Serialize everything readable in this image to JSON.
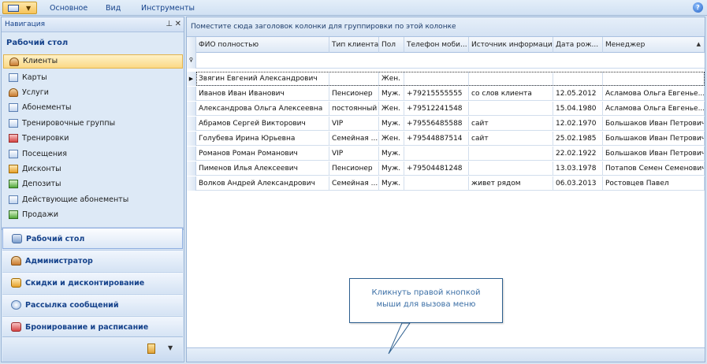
{
  "ribbon": {
    "tabs": [
      "Основное",
      "Вид",
      "Инструменты"
    ],
    "app_button": "app-menu-icon",
    "help_label": "?"
  },
  "nav": {
    "header": "Навигация",
    "pin_icon": "pin-icon",
    "close_icon": "close-icon",
    "title": "Рабочий стол",
    "items": [
      {
        "label": "Клиенты",
        "icon": "person-icon",
        "selected": true
      },
      {
        "label": "Карты",
        "icon": "card-icon"
      },
      {
        "label": "Услуги",
        "icon": "service-icon"
      },
      {
        "label": "Абонементы",
        "icon": "ticket-icon"
      },
      {
        "label": "Тренировочные группы",
        "icon": "group-icon"
      },
      {
        "label": "Тренировки",
        "icon": "calendar-icon"
      },
      {
        "label": "Посещения",
        "icon": "visit-icon"
      },
      {
        "label": "Дисконты",
        "icon": "discount-icon"
      },
      {
        "label": "Депозиты",
        "icon": "deposit-icon"
      },
      {
        "label": "Действующие абонементы",
        "icon": "active-ticket-icon"
      },
      {
        "label": "Продажи",
        "icon": "sales-icon"
      }
    ],
    "groups": [
      {
        "label": "Рабочий стол",
        "icon": "desktop-icon",
        "selected": true
      },
      {
        "label": "Администратор",
        "icon": "admin-icon"
      },
      {
        "label": "Скидки и дисконтирование",
        "icon": "discount-group-icon"
      },
      {
        "label": "Рассылка сообщений",
        "icon": "message-icon"
      },
      {
        "label": "Бронирование и расписание",
        "icon": "schedule-icon"
      }
    ],
    "footer_arrow": "▼"
  },
  "grid": {
    "group_panel_hint": "Поместите сюда заголовок колонки для группировки по этой колонке",
    "columns": [
      "ФИО полностью",
      "Тип клиента",
      "Пол",
      "Телефон моби...",
      "Источник информации",
      "Дата рож...",
      "Менеджер"
    ],
    "sort_indicator": "▲",
    "filter_marker": "♀",
    "current_row_marker": "▶",
    "new_row": [
      "Звягин Евгений Александрович",
      "",
      "Жен.",
      "",
      "",
      "",
      ""
    ],
    "rows": [
      [
        "Иванов Иван Иванович",
        "Пенсионер",
        "Муж.",
        "+79215555555",
        "со слов клиента",
        "12.05.2012",
        "Асламова Ольга Евгенье..."
      ],
      [
        "Александрова Ольга Алексеевна",
        "постоянный",
        "Жен.",
        "+79512241548",
        "",
        "15.04.1980",
        "Асламова Ольга Евгенье..."
      ],
      [
        "Абрамов Сергей Викторович",
        "VIP",
        "Муж.",
        "+79556485588",
        "сайт",
        "12.02.1970",
        "Большаков Иван Петрович"
      ],
      [
        "Голубева Ирина Юрьевна",
        "Семейная ...",
        "Жен.",
        "+79544887514",
        "сайт",
        "25.02.1985",
        "Большаков Иван Петрович"
      ],
      [
        "Романов Роман Романович",
        "VIP",
        "Муж.",
        "",
        "",
        "22.02.1922",
        "Большаков Иван Петрович"
      ],
      [
        "Пименов Илья Алексеевич",
        "Пенсионер",
        "Муж.",
        "+79504481248",
        "",
        "13.03.1978",
        "Потапов Семен Семенович"
      ],
      [
        "Волков Андрей Александрович",
        "Семейная ...",
        "Муж.",
        "",
        "живет рядом",
        "06.03.2013",
        "Ростовцев Павел"
      ]
    ]
  },
  "callout": {
    "line1": "Кликнуть правой кнопкой",
    "line2": "мыши для вызова меню"
  }
}
